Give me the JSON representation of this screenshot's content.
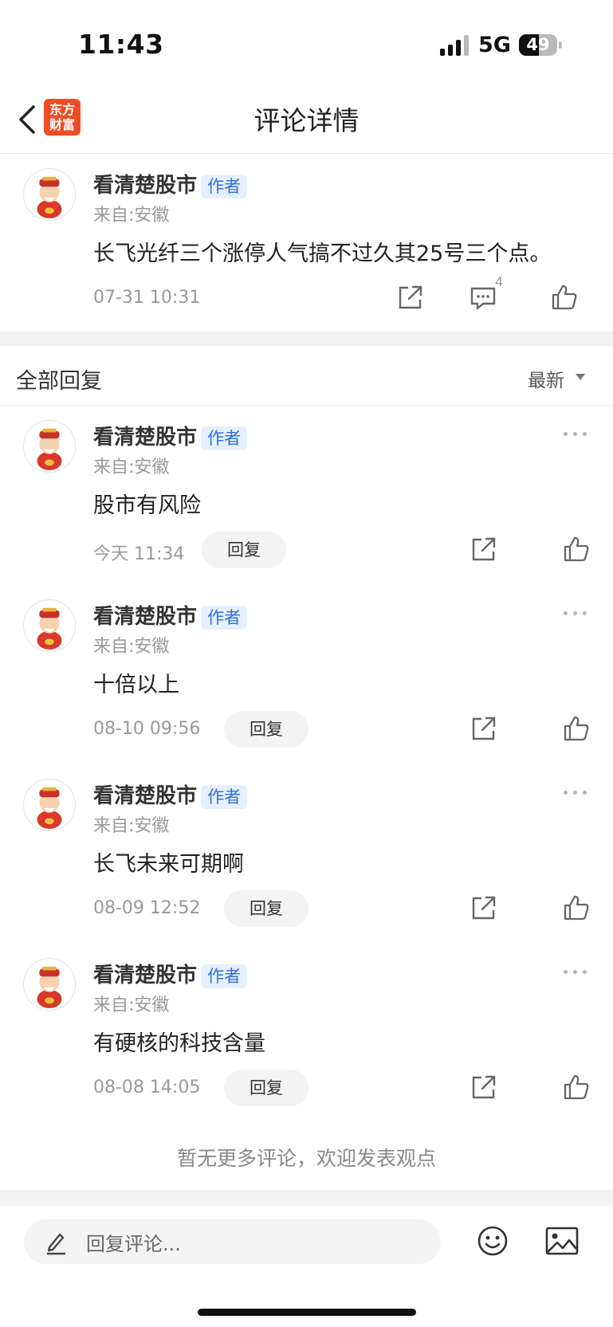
{
  "status_bar": {
    "time": "11:43",
    "network": "5G",
    "battery": "49"
  },
  "nav": {
    "title": "评论详情",
    "logo_line1": "东方",
    "logo_line2": "财富",
    "back_icon": "chevron-left-icon"
  },
  "main_comment": {
    "username": "看清楚股市",
    "badge": "作者",
    "location": "来自:安徽",
    "content": "长飞光纤三个涨停人气搞不过久其25号三个点。",
    "time": "07-31 10:31",
    "comment_count": "4"
  },
  "replies_header": {
    "title": "全部回复",
    "sort": "最新"
  },
  "replies": [
    {
      "username": "看清楚股市",
      "badge": "作者",
      "location": "来自:安徽",
      "content": "股市有风险",
      "time": "今天 11:34",
      "reply_label": "回复"
    },
    {
      "username": "看清楚股市",
      "badge": "作者",
      "location": "来自:安徽",
      "content": "十倍以上",
      "time": "08-10 09:56",
      "reply_label": "回复"
    },
    {
      "username": "看清楚股市",
      "badge": "作者",
      "location": "来自:安徽",
      "content": "长飞未来可期啊",
      "time": "08-09 12:52",
      "reply_label": "回复"
    },
    {
      "username": "看清楚股市",
      "badge": "作者",
      "location": "来自:安徽",
      "content": "有硬核的科技含量",
      "time": "08-08 14:05",
      "reply_label": "回复"
    }
  ],
  "footer_note": "暂无更多评论，欢迎发表观点",
  "input_bar": {
    "placeholder": "回复评论..."
  },
  "colors": {
    "accent": "#2f6fdc",
    "brand": "#ee4d23",
    "badge_bg": "#e6f0fd"
  }
}
